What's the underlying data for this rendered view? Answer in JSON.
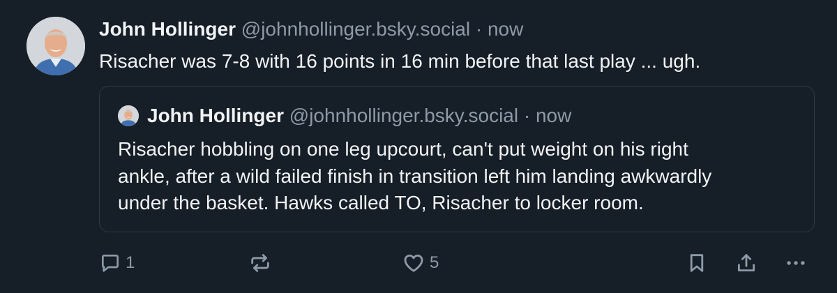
{
  "post": {
    "author_name": "John Hollinger",
    "handle": "@johnhollinger.bsky.social",
    "separator": "·",
    "time": "now",
    "text": "Risacher was 7-8 with 16 points in 16 min before that last play ... ugh."
  },
  "quoted_post": {
    "author_name": "John Hollinger",
    "handle": "@johnhollinger.bsky.social",
    "separator": "·",
    "time": "now",
    "text_lines": [
      "Risacher hobbling on one leg upcourt, can't put weight on his right",
      "ankle, after a wild failed finish in transition left him landing awkwardly",
      "under the basket. Hawks called TO, Risacher to locker room."
    ]
  },
  "actions": {
    "reply_count": "1",
    "like_count": "5",
    "icons": [
      "reply-icon",
      "repost-icon",
      "like-icon",
      "bookmark-icon",
      "share-icon",
      "more-icon"
    ]
  },
  "colors": {
    "background": "#161e27",
    "text": "#f1f3f5",
    "muted": "#8d9aa8",
    "border": "#2e3a48"
  }
}
